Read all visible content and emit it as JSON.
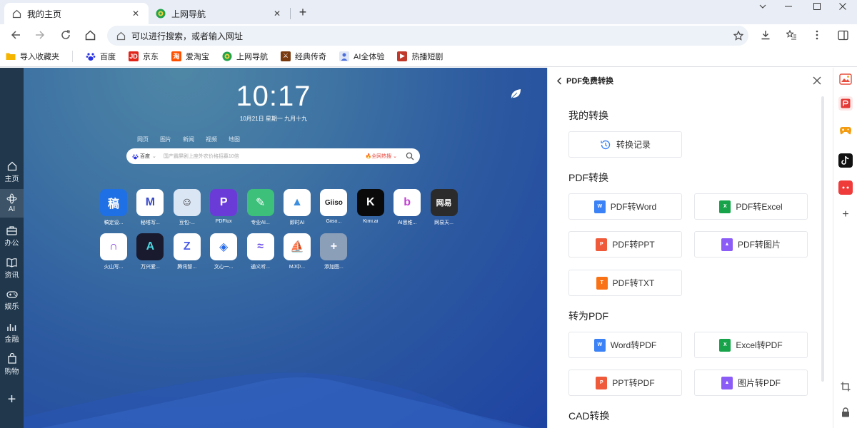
{
  "tabs": [
    {
      "title": "我的主页",
      "active": true
    },
    {
      "title": "上网导航",
      "active": false
    }
  ],
  "window_controls": [
    "chevron-down",
    "minimize",
    "maximize",
    "close"
  ],
  "omnibox": {
    "placeholder": "可以进行搜索，或者输入网址"
  },
  "bookmarks": [
    {
      "label": "导入收藏夹",
      "icon": "folder-icon",
      "color": "#f4b400"
    },
    {
      "label": "百度",
      "icon": "baidu-icon",
      "color": "#2932e1"
    },
    {
      "label": "京东",
      "icon": "jd-icon",
      "color": "#e1251b",
      "glyph": "JD"
    },
    {
      "label": "爱淘宝",
      "icon": "taobao-icon",
      "color": "#ff5000",
      "glyph": "淘"
    },
    {
      "label": "上网导航",
      "icon": "nav-icon",
      "color": "#22a34a"
    },
    {
      "label": "经典传奇",
      "icon": "game-icon",
      "color": "#7a3a10"
    },
    {
      "label": "AI全体验",
      "icon": "ai-icon",
      "color": "#4a6fdc"
    },
    {
      "label": "热播短剧",
      "icon": "drama-icon",
      "color": "#c0392b"
    }
  ],
  "leftbar": [
    {
      "label": "主页",
      "icon": "home-icon"
    },
    {
      "label": "AI",
      "icon": "ai-gear-icon",
      "active": true
    },
    {
      "label": "办公",
      "icon": "briefcase-icon"
    },
    {
      "label": "资讯",
      "icon": "book-icon"
    },
    {
      "label": "娱乐",
      "icon": "gamepad-icon"
    },
    {
      "label": "金融",
      "icon": "finance-icon"
    },
    {
      "label": "购物",
      "icon": "bag-icon"
    }
  ],
  "leftbar_add": "+",
  "newtab": {
    "time": "10:17",
    "date": "10月21日 星期一 九月十九",
    "search_tabs": [
      "网页",
      "图片",
      "新闻",
      "视频",
      "地图"
    ],
    "search_engine": "百度",
    "search_placeholder": "国产霸屏剧上座外农价格招募10倍",
    "hot_label": "全网热搜"
  },
  "apps": [
    {
      "label": "稿定设...",
      "glyph": "稿",
      "color": "#1f6fe5"
    },
    {
      "label": "秘塔写...",
      "glyph": "M",
      "color": "#ffffff",
      "fg": "#3b4cca"
    },
    {
      "label": "豆包-...",
      "glyph": "☺",
      "color": "#dbe6f5",
      "fg": "#333"
    },
    {
      "label": "PDFlux",
      "glyph": "P",
      "color": "#6b3bd8"
    },
    {
      "label": "专业AI...",
      "glyph": "✎",
      "color": "#3cc07a"
    },
    {
      "label": "即时AI",
      "glyph": "▲",
      "color": "#ffffff",
      "fg": "#3b8ee0"
    },
    {
      "label": "Giiso...",
      "glyph": "Giiso",
      "color": "#ffffff",
      "fg": "#222"
    },
    {
      "label": "Kimi.ai",
      "glyph": "K",
      "color": "#0a0a0a"
    },
    {
      "label": "AI思维...",
      "glyph": "b",
      "color": "#ffffff",
      "fg": "#c23fd4"
    },
    {
      "label": "网易天...",
      "glyph": "网易",
      "color": "#2b2b2b"
    },
    {
      "label": "火山写...",
      "glyph": "∩",
      "color": "#ffffff",
      "fg": "#7a3ad8"
    },
    {
      "label": "万兴爱...",
      "glyph": "A",
      "color": "#1a1a2e",
      "fg": "#4ad6e0"
    },
    {
      "label": "腾讯智...",
      "glyph": "Z",
      "color": "#ffffff",
      "fg": "#4b5de8"
    },
    {
      "label": "文心一...",
      "glyph": "◈",
      "color": "#ffffff",
      "fg": "#2468e8"
    },
    {
      "label": "通义听...",
      "glyph": "≈",
      "color": "#ffffff",
      "fg": "#6b4de8"
    },
    {
      "label": "MJ中...",
      "glyph": "⛵",
      "color": "#ffffff",
      "fg": "#b03030"
    },
    {
      "label": "添加图...",
      "glyph": "+",
      "color": "#8c9fb8"
    }
  ],
  "panel": {
    "title": "PDF免费转换",
    "sections": [
      {
        "title": "我的转换",
        "buttons": [
          {
            "label": "转换记录",
            "icon": "history-icon"
          }
        ]
      },
      {
        "title": "PDF转换",
        "buttons": [
          {
            "label": "PDF转Word",
            "icon": "word-file-icon",
            "color": "#3b82f6",
            "glyph": "W"
          },
          {
            "label": "PDF转Excel",
            "icon": "excel-file-icon",
            "color": "#16a34a",
            "glyph": "X"
          },
          {
            "label": "PDF转PPT",
            "icon": "ppt-file-icon",
            "color": "#ef5b3a",
            "glyph": "P"
          },
          {
            "label": "PDF转图片",
            "icon": "image-file-icon",
            "color": "#8b5cf6",
            "glyph": "▲"
          },
          {
            "label": "PDF转TXT",
            "icon": "txt-file-icon",
            "color": "#f97316",
            "glyph": "T"
          }
        ]
      },
      {
        "title": "转为PDF",
        "buttons": [
          {
            "label": "Word转PDF",
            "icon": "word-file-icon",
            "color": "#3b82f6",
            "glyph": "W"
          },
          {
            "label": "Excel转PDF",
            "icon": "excel-file-icon",
            "color": "#16a34a",
            "glyph": "X"
          },
          {
            "label": "PPT转PDF",
            "icon": "ppt-file-icon",
            "color": "#ef5b3a",
            "glyph": "P"
          },
          {
            "label": "图片转PDF",
            "icon": "image-file-icon",
            "color": "#8b5cf6",
            "glyph": "▲"
          }
        ]
      },
      {
        "title": "CAD转换",
        "buttons": []
      }
    ]
  },
  "rail": [
    {
      "icon": "gallery-icon",
      "color": "#e74c3c"
    },
    {
      "icon": "pdf-convert-icon",
      "color": "#e53935",
      "active": true
    },
    {
      "icon": "game-controller-icon",
      "color": "#f39c12"
    },
    {
      "icon": "douyin-icon",
      "color": "#111111"
    },
    {
      "icon": "red-app-icon",
      "color": "#f03b3b"
    },
    {
      "icon": "add-icon",
      "color": "#444444"
    }
  ],
  "colors": {
    "tabstrip_bg": "#e9eef6",
    "leftbar_bg": "#20374c",
    "hot_red": "#e8443a"
  }
}
